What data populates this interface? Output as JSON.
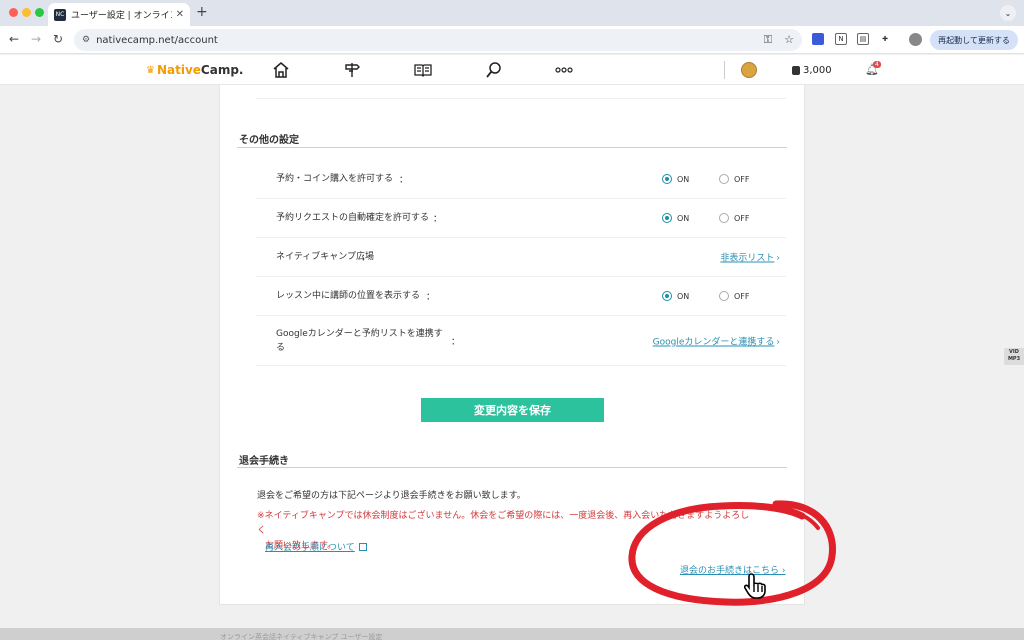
{
  "browser": {
    "tab_title": "ユーザー設定 | オンライン英会話",
    "tab_favicon": "NC",
    "url": "nativecamp.net/account",
    "relaunch_label": "再起動して更新する"
  },
  "site": {
    "logo_native": "Native",
    "logo_camp": "Camp.",
    "coins": "3,000",
    "notification_count": "4",
    "nav_icons": [
      "home-icon",
      "signpost-icon",
      "book-icon",
      "search-icon",
      "more-icon"
    ]
  },
  "other_settings": {
    "title": "その他の設定",
    "on_label": "ON",
    "off_label": "OFF",
    "rows": [
      {
        "label": "予約・コイン購入を許可する",
        "colon": "：",
        "type": "radio",
        "selected": "ON"
      },
      {
        "label": "予約リクエストの自動確定を許可する",
        "colon": "：",
        "type": "radio",
        "selected": "ON"
      },
      {
        "label": "ネイティブキャンプ広場",
        "colon": "：",
        "type": "link",
        "link": "非表示リスト"
      },
      {
        "label": "レッスン中に講師の位置を表示する",
        "colon": "：",
        "type": "radio",
        "selected": "ON"
      },
      {
        "label_line1": "Googleカレンダーと予約リストを連携す",
        "label_line2": "る",
        "colon": "：",
        "type": "link",
        "link": "Googleカレンダーと連携する"
      }
    ]
  },
  "save_button": "変更内容を保存",
  "withdrawal": {
    "title": "退会手続き",
    "description": "退会をご希望の方は下記ページより退会手続きをお願い致します。",
    "warning_line1": "※ネイティブキャンプでは休会制度はございません。休会をご希望の際には、一度退会後、再入会いただきますようよろしく",
    "warning_line2": "お願い致します。",
    "rejoin_link": "再入会の手順について",
    "withdraw_link": "退会のお手続きはこちら"
  },
  "side_badge": {
    "line1": "VID",
    "line2": "MP3"
  },
  "footer_text": "オンライン英会話ネイティブキャンプ ユーザー設定",
  "colors": {
    "accent": "#2bc29d",
    "link": "#2a8fb4",
    "warning": "#d23a3a",
    "radio": "#1a8fa5",
    "annotation": "#e0202a"
  }
}
